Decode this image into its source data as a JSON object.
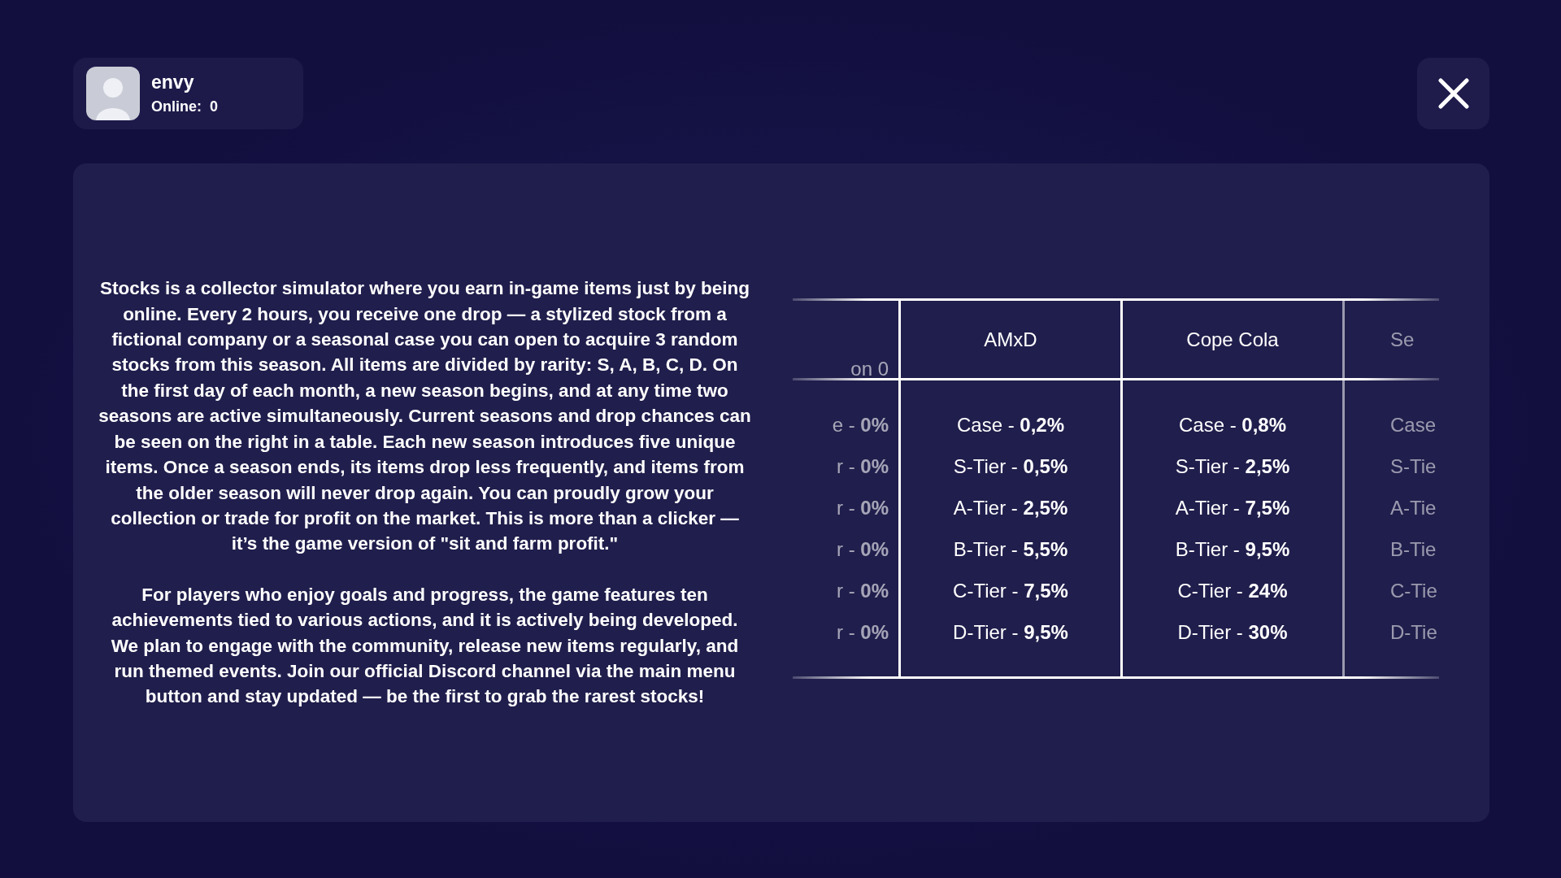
{
  "profile": {
    "name": "envy",
    "online_label": "Online:",
    "online_count": "0"
  },
  "description": [
    "Stocks is a collector simulator where you earn in-game items just by being online. Every 2 hours, you receive one drop — a stylized stock from a fictional company or a seasonal case you can open to acquire 3 random stocks from this season. All items are divided by rarity: S, A, B, C, D. On the first day of each month, a new season begins, and at any time two seasons are active simultaneously. Current seasons and drop chances can be seen on the right in a table. Each new season introduces five unique items. Once a season ends, its items drop less frequently, and items from the older season will never drop again. You can proudly grow your collection or trade for profit on the market. This is more than a clicker — it’s the game version of \"sit and farm profit.\"",
    "For players who enjoy goals and progress, the game features ten achievements tied to various actions, and it is actively being developed. We plan to engage with the community, release new items regularly, and run themed events. Join our official Discord channel via the main menu button and stay updated — be the first to grab the rarest stocks!"
  ],
  "table": {
    "columns": [
      {
        "kind": "cut-left",
        "header": "on 0",
        "cells": [
          "e - **0%**",
          "r - **0%**",
          "r - **0%**",
          "r - **0%**",
          "r - **0%**",
          "r - **0%**"
        ]
      },
      {
        "kind": "full",
        "header": "AMxD",
        "cells": [
          "Case - **0,2%**",
          "S-Tier - **0,5%**",
          "A-Tier - **2,5%**",
          "B-Tier - **5,5%**",
          "C-Tier - **7,5%**",
          "D-Tier - **9,5%**"
        ]
      },
      {
        "kind": "full",
        "header": "Cope Cola",
        "cells": [
          "Case - **0,8%**",
          "S-Tier - **2,5%**",
          "A-Tier - **7,5%**",
          "B-Tier - **9,5%**",
          "C-Tier - **24%**",
          "D-Tier - **30%**"
        ]
      },
      {
        "kind": "cut-right",
        "header": "Se",
        "cells": [
          "Case",
          "S-Tie",
          "A-Tie",
          "B-Tie",
          "C-Tie",
          "D-Tie"
        ]
      }
    ]
  }
}
